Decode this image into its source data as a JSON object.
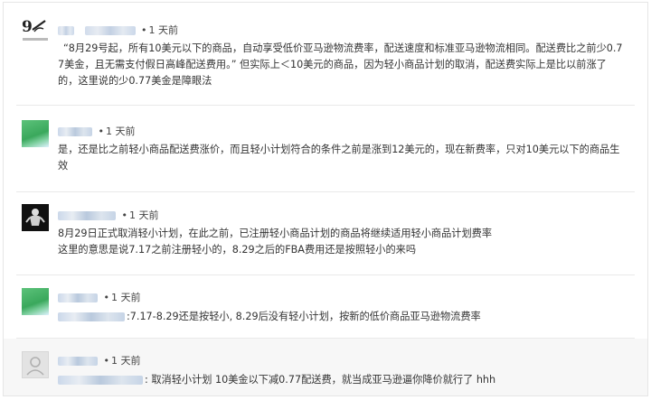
{
  "comments": [
    {
      "time": "1 天前",
      "lines": [
        "“8月29号起，所有10美元以下的商品，自动享受低价亚马逊物流费率，配送速度和标准亚马逊物流相同。配送费比之前少0.7",
        "7美金，且无需支付假日高峰配送费用。” 但实际上＜10美元的商品，因为轻小商品计划的取消，配送费实际上是比以前涨了",
        "的，这里说的少0.77美金是障眼法"
      ]
    },
    {
      "time": "1 天前",
      "lines": [
        "是，还是比之前轻小商品配送费涨价，而且轻小计划符合的条件之前是涨到12美元的，现在新费率，只对10美元以下的商品生",
        "效"
      ]
    },
    {
      "time": "1 天前",
      "lines": [
        "8月29日正式取消轻小计划，在此之前，已注册轻小商品计划的商品将继续适用轻小商品计划费率",
        "这里的意思是说7.17之前注册轻小的，8.29之后的FBA费用还是按照轻小的来吗"
      ]
    },
    {
      "time": "1 天前",
      "lines": [
        ":7.17-8.29还是按轻小, 8.29后没有轻小计划，按新的低价商品亚马逊物流费率"
      ]
    },
    {
      "time": "1 天前",
      "lines": [
        ": 取消轻小计划 10美金以下减0.77配送费，就当成亚马逊逼你降价就行了 hhh"
      ]
    }
  ],
  "colors": {
    "text": "#333333",
    "meta": "#444444",
    "shaded_bg": "#f7f7f7",
    "divider": "#e9e9e9"
  }
}
